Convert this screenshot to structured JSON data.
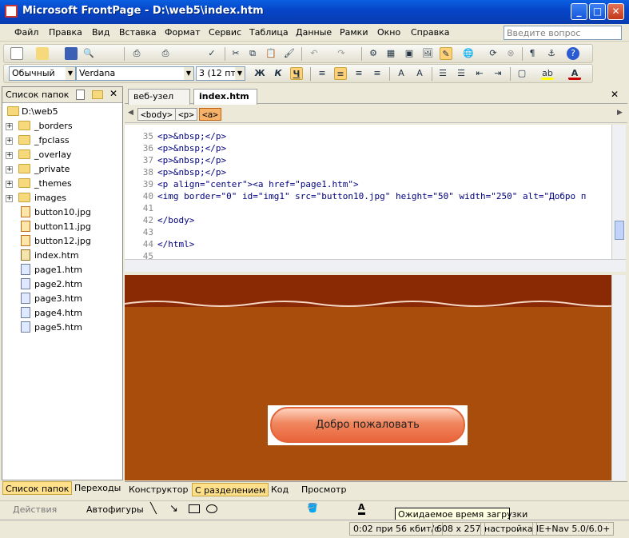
{
  "window": {
    "title": "Microsoft FrontPage - D:\\web5\\index.htm"
  },
  "menu": [
    "Файл",
    "Правка",
    "Вид",
    "Вставка",
    "Формат",
    "Сервис",
    "Таблица",
    "Данные",
    "Рамки",
    "Окно",
    "Справка"
  ],
  "help_placeholder": "Введите вопрос",
  "format_bar": {
    "style": "Обычный",
    "font": "Verdana",
    "size": "3  (12 пт)",
    "bold": "Ж",
    "italic": "К",
    "underline": "Ч"
  },
  "folder_panel": {
    "title": "Список папок",
    "root": "D:\\web5",
    "folders": [
      "_borders",
      "_fpclass",
      "_overlay",
      "_private",
      "_themes",
      "images"
    ],
    "files": [
      {
        "name": "button10.jpg",
        "type": "jpg"
      },
      {
        "name": "button11.jpg",
        "type": "jpg"
      },
      {
        "name": "button12.jpg",
        "type": "jpg"
      },
      {
        "name": "index.htm",
        "type": "home"
      },
      {
        "name": "page1.htm",
        "type": "htm"
      },
      {
        "name": "page2.htm",
        "type": "htm"
      },
      {
        "name": "page3.htm",
        "type": "htm"
      },
      {
        "name": "page4.htm",
        "type": "htm"
      },
      {
        "name": "page5.htm",
        "type": "htm"
      }
    ],
    "tabs": [
      "Список папок",
      "Переходы"
    ]
  },
  "doc_tabs": [
    "веб-узел",
    "index.htm"
  ],
  "tag_path": [
    "<body>",
    "<p>",
    "<a>"
  ],
  "code_lines": [
    {
      "n": "35",
      "text": "<p>&nbsp;</p>"
    },
    {
      "n": "36",
      "text": "<p>&nbsp;</p>"
    },
    {
      "n": "37",
      "text": "<p>&nbsp;</p>"
    },
    {
      "n": "38",
      "text": "<p>&nbsp;</p>"
    },
    {
      "n": "39",
      "text": "<p align=\"center\"><a href=\"page1.htm\">"
    },
    {
      "n": "40",
      "text": "<img border=\"0\" id=\"img1\" src=\"button10.jpg\" height=\"50\" width=\"250\" alt=\"Добро п"
    },
    {
      "n": "41",
      "text": ""
    },
    {
      "n": "42",
      "text": "</body>"
    },
    {
      "n": "43",
      "text": ""
    },
    {
      "n": "44",
      "text": "</html>"
    },
    {
      "n": "45",
      "text": ""
    }
  ],
  "design": {
    "button_text": "Добро пожаловать"
  },
  "view_tabs": [
    "Конструктор",
    "С разделением",
    "Код",
    "Просмотр"
  ],
  "draw_bar": {
    "actions": "Действия",
    "autoshapes": "Автофигуры"
  },
  "tooltip": "Ожидаемое время загрузки",
  "status": [
    "0:02 при 56 кбит/с",
    "608 x 257",
    "настройка",
    "IE+Nav 5.0/6.0+"
  ]
}
